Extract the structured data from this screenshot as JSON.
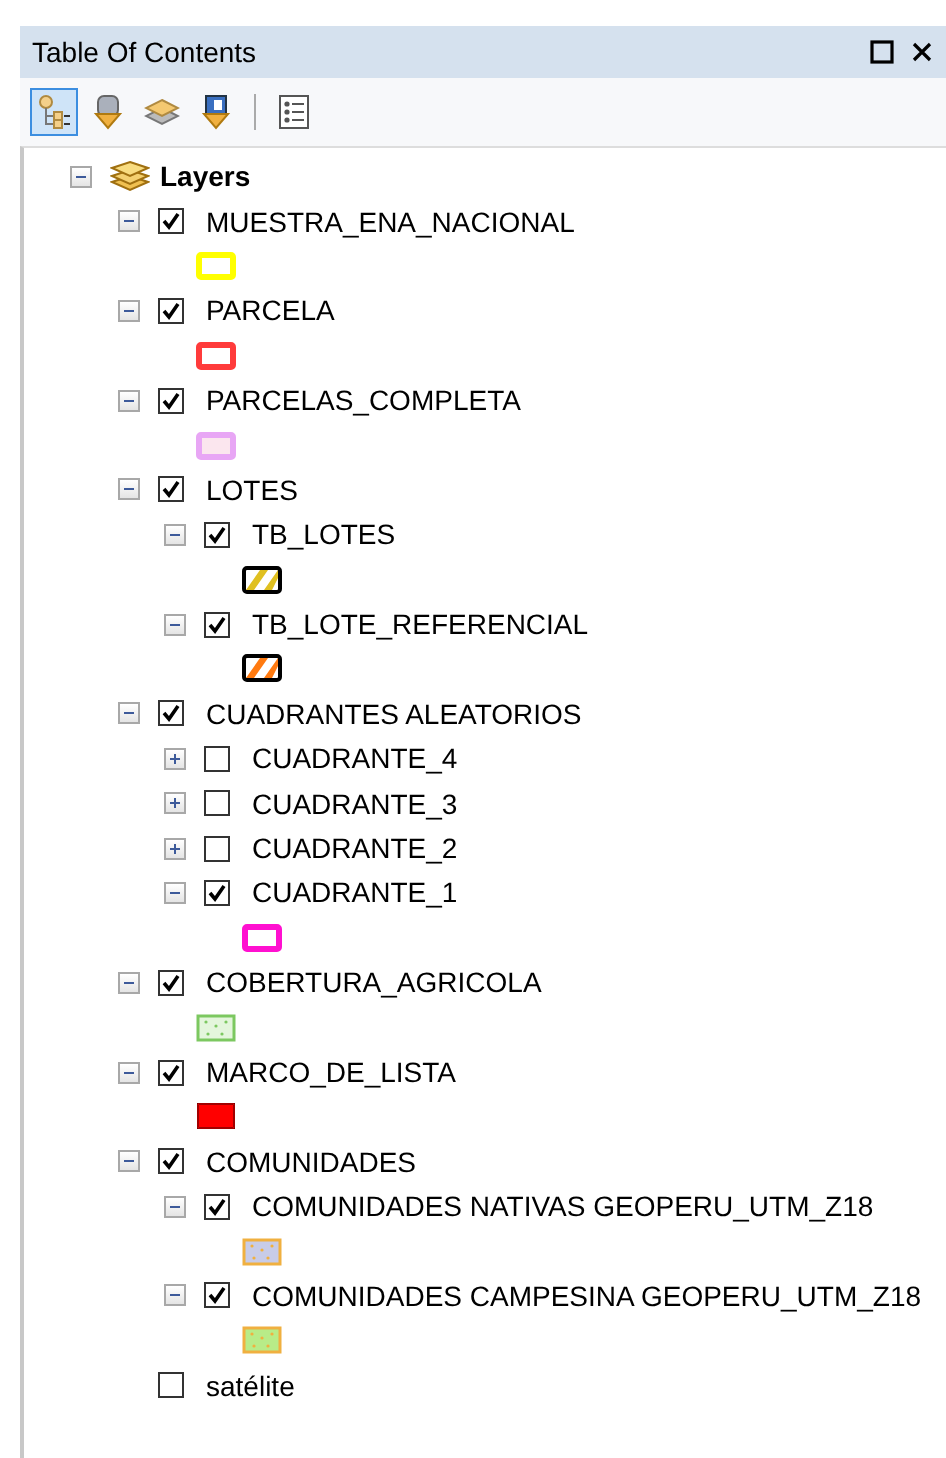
{
  "window": {
    "title": "Table Of Contents"
  },
  "toolbar": [
    {
      "kind": "drawing_order",
      "selected": true
    },
    {
      "kind": "source",
      "selected": false
    },
    {
      "kind": "visibility",
      "selected": false
    },
    {
      "kind": "selection",
      "selected": false
    },
    {
      "kind": "options",
      "selected": false
    }
  ],
  "map": {
    "label": "Layers",
    "expanded": true,
    "layers": [
      {
        "label": "MUESTRA_ENA_NACIONAL",
        "expanded": true,
        "checked": true,
        "symbol": {
          "kind": "outline",
          "color": "#ffff00"
        }
      },
      {
        "label": "PARCELA",
        "expanded": true,
        "checked": true,
        "symbol": {
          "kind": "outline",
          "color": "#ff3b3b"
        }
      },
      {
        "label": "PARCELAS_COMPLETA",
        "expanded": true,
        "checked": true,
        "symbol": {
          "kind": "outline",
          "color": "#e8a6f5",
          "fill": {
            "color": "#fbe6ee"
          }
        }
      },
      {
        "label": "LOTES",
        "expanded": true,
        "checked": true,
        "children": [
          {
            "label": "TB_LOTES",
            "expanded": true,
            "checked": true,
            "symbol": {
              "kind": "hatch",
              "color": "#e0c020"
            }
          },
          {
            "label": "TB_LOTE_REFERENCIAL",
            "expanded": true,
            "checked": true,
            "symbol": {
              "kind": "hatch",
              "color": "#ff7a10"
            }
          }
        ]
      },
      {
        "label": "CUADRANTES ALEATORIOS",
        "expanded": true,
        "checked": true,
        "children": [
          {
            "label": "CUADRANTE_4",
            "expanded": false,
            "checked": false
          },
          {
            "label": "CUADRANTE_3",
            "expanded": false,
            "checked": false
          },
          {
            "label": "CUADRANTE_2",
            "expanded": false,
            "checked": false
          },
          {
            "label": "CUADRANTE_1",
            "expanded": true,
            "checked": true,
            "symbol": {
              "kind": "outline",
              "color": "#ff10d0"
            }
          }
        ]
      },
      {
        "label": "COBERTURA_AGRICOLA",
        "expanded": true,
        "checked": true,
        "symbol": {
          "kind": "dots",
          "color": "#7cc860",
          "fill": {
            "color": "#e4f6dc"
          }
        }
      },
      {
        "label": "MARCO_DE_LISTA",
        "expanded": true,
        "checked": true,
        "symbol": {
          "kind": "fill",
          "color": "#ff0000",
          "fill": {
            "color": "#ff0000"
          }
        }
      },
      {
        "label": "COMUNIDADES",
        "expanded": true,
        "checked": true,
        "children": [
          {
            "label": "COMUNIDADES NATIVAS GEOPERU_UTM_Z18",
            "expanded": true,
            "checked": true,
            "symbol": {
              "kind": "dots",
              "color": "#f0b040",
              "fill": {
                "color": "#c8cce8"
              }
            }
          },
          {
            "label": "COMUNIDADES CAMPESINA GEOPERU_UTM_Z18",
            "expanded": true,
            "checked": true,
            "symbol": {
              "kind": "dots",
              "color": "#f0b040",
              "fill": {
                "color": "#b8ec88"
              }
            }
          }
        ]
      },
      {
        "label": "satélite",
        "checked": false
      }
    ]
  }
}
